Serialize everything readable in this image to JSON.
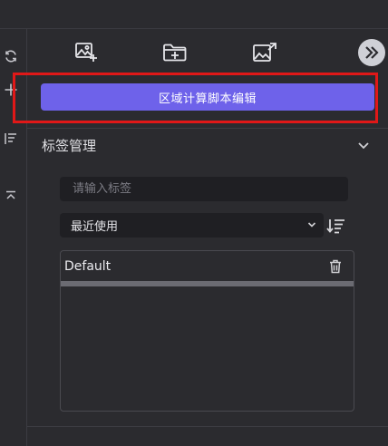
{
  "toolbar": {
    "icons": [
      "add-image-icon",
      "add-folder-icon",
      "export-image-icon",
      "double-chevron-right-icon"
    ]
  },
  "left_rail": {
    "icons": [
      "refresh-icon",
      "plus-icon",
      "list-sort-icon",
      "collapse-top-icon"
    ]
  },
  "script_button": {
    "label": "区域计算脚本编辑",
    "color": "#6e62ea"
  },
  "highlight_color": "#e01818",
  "tag_manager": {
    "title": "标签管理",
    "input_placeholder": "请输入标签",
    "input_value": "",
    "sort_selected": "最近使用",
    "tags": [
      {
        "label": "Default"
      }
    ]
  }
}
